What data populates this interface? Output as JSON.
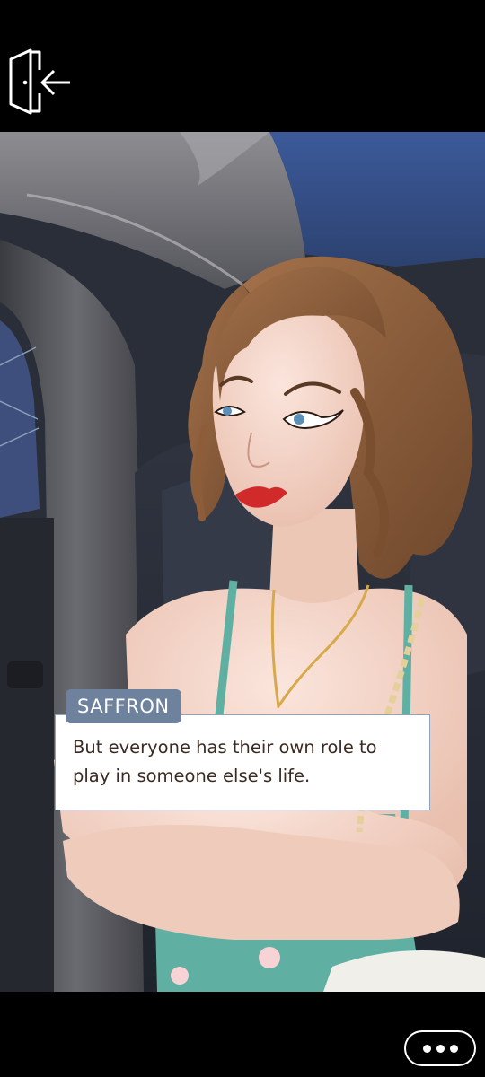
{
  "dialog": {
    "speaker": "SAFFRON",
    "text": "But everyone has their own role to play in someone else's life."
  },
  "icons": {
    "exit": "exit-door-icon",
    "more": "more-options-icon"
  },
  "colors": {
    "speaker_tag": "#6f829d",
    "dialog_border": "#8ea1bd",
    "dialog_text": "#3a2a20"
  }
}
